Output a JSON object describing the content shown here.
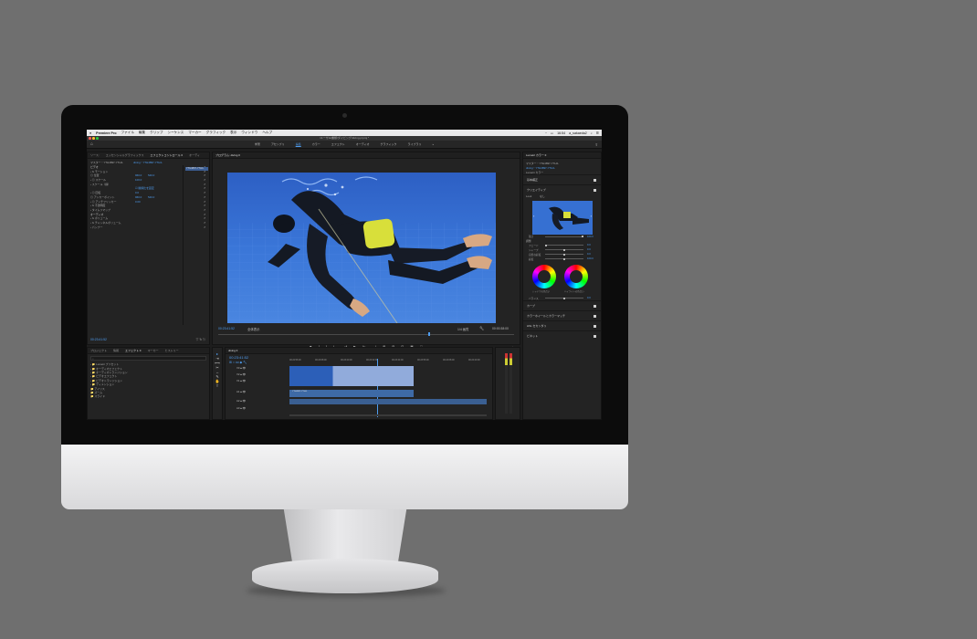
{
  "menubar": {
    "apple": "",
    "app_name": "Premiere Pro",
    "items": [
      "ファイル",
      "編集",
      "クリップ",
      "シーケンス",
      "マーカー",
      "グラフィック",
      "表示",
      "ウィンドウ",
      "ヘルプ"
    ],
    "clock": "16:54",
    "user": "a_sakaeda2"
  },
  "window": {
    "title": "/ユーザ/a/書類/ダイビング/diving.prproj *"
  },
  "workspaces": {
    "items": [
      "学習",
      "アセンブリ",
      "編集",
      "カラー",
      "エフェクト",
      "オーディオ",
      "グラフィック",
      "ライブラリ"
    ],
    "active_index": 2,
    "more": "»"
  },
  "effect_controls": {
    "tabs": [
      "ソース: ",
      "エッセンシャルグラフィックス",
      "エフェクトコントロール ≡",
      "オーディ"
    ],
    "master": "マスター・YTH4897-YTH4-",
    "sequence": "diving・YTH4897-YTH4-",
    "clip_chip": "YTH4897-YTH4-",
    "rows": [
      {
        "label": "ビデオ",
        "hdr": true,
        "v1": "",
        "v2": ""
      },
      {
        "label": "› fx モーション",
        "hdr": false,
        "v1": "",
        "v2": ""
      },
      {
        "label": "  ◎ 位置",
        "hdr": false,
        "v1": "960.0",
        "v2": "540.0"
      },
      {
        "label": "› ◎ スケール",
        "hdr": false,
        "v1": "100.0",
        "v2": ""
      },
      {
        "label": "  › スケール（横）",
        "hdr": false,
        "v1": "",
        "v2": ""
      },
      {
        "label": "",
        "hdr": false,
        "v1": "☑ 縦横比を固定",
        "v2": ""
      },
      {
        "label": "› ◎ 回転",
        "hdr": false,
        "v1": "0.0",
        "v2": ""
      },
      {
        "label": "  ◎ アンカーポイント",
        "hdr": false,
        "v1": "960.0",
        "v2": "540.0"
      },
      {
        "label": "› ◎ アンチフリッカー",
        "hdr": false,
        "v1": "0.00",
        "v2": ""
      },
      {
        "label": "› fx 不透明度",
        "hdr": false,
        "v1": "",
        "v2": ""
      },
      {
        "label": "› タイムリマップ",
        "hdr": false,
        "v1": "",
        "v2": ""
      },
      {
        "label": "オーディオ",
        "hdr": true,
        "v1": "",
        "v2": ""
      },
      {
        "label": "› fx ボリューム",
        "hdr": false,
        "v1": "",
        "v2": ""
      },
      {
        "label": "› fx チャンネルボリューム",
        "hdr": false,
        "v1": "",
        "v2": ""
      },
      {
        "label": "› パンナー",
        "hdr": false,
        "v1": "",
        "v2": ""
      }
    ],
    "timecode": "00:23:41:52"
  },
  "program": {
    "tab": "プログラム: diving ≡",
    "timecode": "00:23:41:52",
    "fit": "全体表示",
    "quality": "1/4 画質",
    "duration": "00:00:38:00",
    "transport": [
      "◆",
      "{",
      "}",
      "|←",
      "◁|",
      "▶",
      "|▷",
      "→|",
      "⊞",
      "⊟",
      "⊡",
      "▣",
      "⬚"
    ]
  },
  "project": {
    "tabs": [
      "プロジェクト",
      "情報",
      "エフェクト ≡",
      "マーカー",
      "ヒストリー"
    ],
    "search_placeholder": "",
    "items": [
      "› 📁 Lumetri プリセット",
      "› 📁 オーディオエフェクト",
      "› 📁 オーディオトランジション",
      "› 📁 ビデオエフェクト",
      "› 📁 ビデオトランジション",
      "› 📁 ディメンション",
      "   📁 アイリス",
      "   📁 ズーム",
      "   📁 スライド"
    ]
  },
  "timeline": {
    "tab": "diving ≡",
    "timecode": "00:23:41:52",
    "ruler": [
      "00:22:56:00",
      "00:23:08:00",
      "00:23:20:00",
      "00:23:32:00",
      "00:23:44:00",
      "00:23:56:00",
      "00:24:08:00",
      "00:24:20:00"
    ],
    "video_tracks": [
      "V3",
      "V2",
      "V1"
    ],
    "audio_tracks": [
      "A1",
      "A2",
      "A3"
    ],
    "clip_label": "YTH4897-YTH4-"
  },
  "lumetri": {
    "tab": "Lumetri カラー ≡",
    "master": "マスター・YTH4897-YTH4-",
    "sequence": "diving・YTH4897-YTH4-",
    "preset_label": "Lumetri カラー",
    "sections": [
      "基本補正",
      "クリエイティブ",
      "カーブ",
      "カラーホイールとカラーマッチ",
      "HSL セカンダリ",
      "ビネット"
    ],
    "look_label": "Look",
    "look_value": "なし",
    "intensity_label": "強さ",
    "intensity_value": "100.0",
    "adjust_label": "調整",
    "sliders": [
      {
        "label": "フェード",
        "value": "0.0",
        "pos": 0.0
      },
      {
        "label": "シャープ",
        "value": "0.0",
        "pos": 0.5
      },
      {
        "label": "自然な彩度",
        "value": "0.0",
        "pos": 0.5
      },
      {
        "label": "彩度",
        "value": "100.0",
        "pos": 0.5
      }
    ],
    "wheel_left": "シャドウの色合い",
    "wheel_right": "ハイライトの色合い",
    "balance_label": "バランス",
    "balance_value": "0.0"
  },
  "colors": {
    "accent": "#4f9df0",
    "panel_bg": "#232323",
    "water": "#2f67c9",
    "wetsuit": "#141923",
    "yellow_tank": "#d8df3a"
  }
}
